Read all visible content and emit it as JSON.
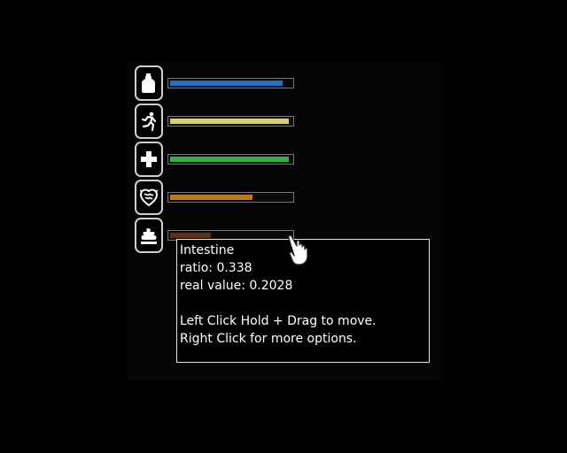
{
  "needs": [
    {
      "key": "thirst",
      "icon": "bottle-icon",
      "ratio": 0.93,
      "color": "#1e74c4"
    },
    {
      "key": "energy",
      "icon": "running-person-icon",
      "ratio": 0.98,
      "color": "#d9cf6c"
    },
    {
      "key": "health",
      "icon": "health-cross-icon",
      "ratio": 0.98,
      "color": "#2fb13b"
    },
    {
      "key": "stress",
      "icon": "brain-icon",
      "ratio": 0.68,
      "color": "#c07a17"
    },
    {
      "key": "intestine",
      "icon": "poop-icon",
      "ratio": 0.338,
      "color": "#5a2f12"
    }
  ],
  "tooltip": {
    "name": "Intestine",
    "ratio_line": "ratio: 0.338",
    "real_value_line": "real value: 0.2028",
    "hint_move": "Left Click Hold + Drag to move.",
    "hint_options": "Right Click for more options."
  },
  "cursor_icon": "hand-pointer-icon"
}
